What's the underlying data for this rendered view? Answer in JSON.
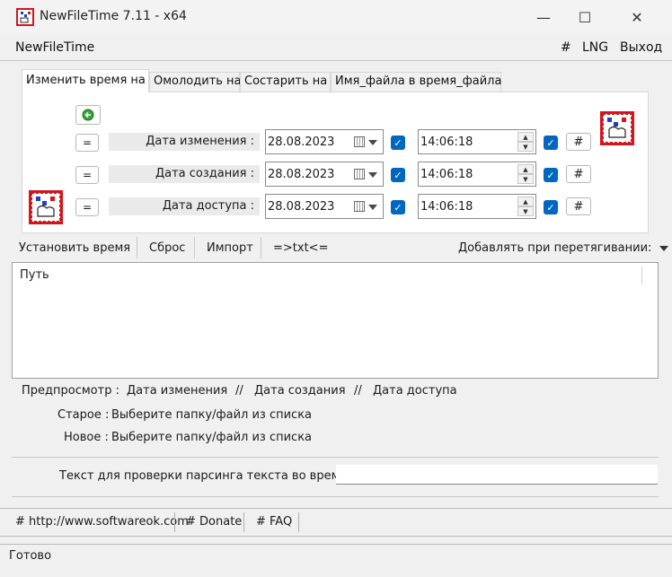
{
  "window": {
    "title": "NewFileTime 7.11 - x64",
    "minimize_glyph": "—",
    "maximize_glyph": "☐",
    "close_glyph": "✕"
  },
  "menu": {
    "app_name": "NewFileTime",
    "hash": "#",
    "lng": "LNG",
    "exit": "Выход"
  },
  "tabs": [
    {
      "label": "Изменить время на",
      "active": true
    },
    {
      "label": "Омолодить на",
      "active": false
    },
    {
      "label": "Состарить на",
      "active": false
    },
    {
      "label": "Имя_файла в время_файла",
      "active": false
    }
  ],
  "rows": [
    {
      "equal": "=",
      "label": "Дата изменения :",
      "date": "28.08.2023",
      "time": "14:06:18",
      "hash": "#"
    },
    {
      "equal": "=",
      "label": "Дата создания :",
      "date": "28.08.2023",
      "time": "14:06:18",
      "hash": "#"
    },
    {
      "equal": "=",
      "label": "Дата доступа :",
      "date": "28.08.2023",
      "time": "14:06:18",
      "hash": "#"
    }
  ],
  "toolbar": {
    "set_time": "Установить время",
    "reset": "Сброс",
    "import": "Импорт",
    "txt": "=>txt<=",
    "add_on_drag": "Добавлять при перетягивании:"
  },
  "list": {
    "column_path": "Путь"
  },
  "preview": {
    "label": "Предпросмотр :",
    "col1": "Дата изменения",
    "sep": "//",
    "col2": "Дата создания",
    "col3": "Дата доступа",
    "old_label": "Старое :",
    "old_value": "Выберите папку/файл из списка",
    "new_label": "Новое :",
    "new_value": "Выберите папку/файл из списка"
  },
  "parse": {
    "label": "Текст для проверки парсинга текста во время",
    "value": ""
  },
  "links": {
    "website": "# http://www.softwareok.com",
    "donate": "# Donate",
    "faq": "# FAQ"
  },
  "status": {
    "text": "Готово"
  },
  "colors": {
    "accent": "#0067c0",
    "icon_red": "#d4141e",
    "icon_blue": "#1f3fbf"
  }
}
